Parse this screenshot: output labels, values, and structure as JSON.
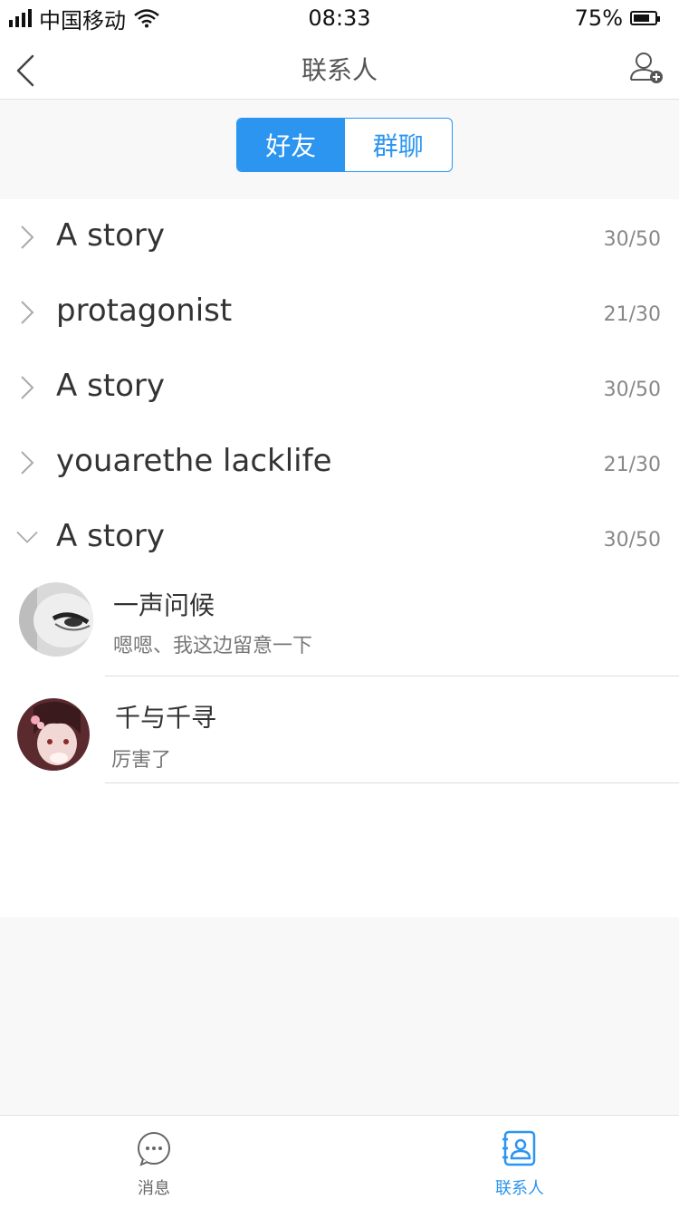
{
  "status": {
    "carrier": "中国移动",
    "time": "08:33",
    "battery": "75%",
    "battery_level": 0.75
  },
  "nav": {
    "title": "联系人"
  },
  "segment": {
    "tabs": [
      {
        "label": "好友",
        "active": true
      },
      {
        "label": "群聊",
        "active": false
      }
    ]
  },
  "groups": [
    {
      "name": "A story",
      "count": "30/50",
      "expanded": false
    },
    {
      "name": "protagonist",
      "count": "21/30",
      "expanded": false
    },
    {
      "name": "A story",
      "count": "30/50",
      "expanded": false
    },
    {
      "name": "youarethe lacklife",
      "count": "21/30",
      "expanded": false
    },
    {
      "name": "A story",
      "count": "30/50",
      "expanded": true
    }
  ],
  "contacts": [
    {
      "name": "一声问候",
      "message": "嗯嗯、我这边留意一下"
    },
    {
      "name": "千与千寻",
      "message": "厉害了"
    }
  ],
  "tabbar": {
    "items": [
      {
        "label": "消息",
        "icon": "chat-bubble-icon",
        "active": false
      },
      {
        "label": "联系人",
        "icon": "contacts-book-icon",
        "active": true
      }
    ]
  },
  "colors": {
    "accent": "#2b95f0",
    "inactive_tab": "#666666"
  }
}
